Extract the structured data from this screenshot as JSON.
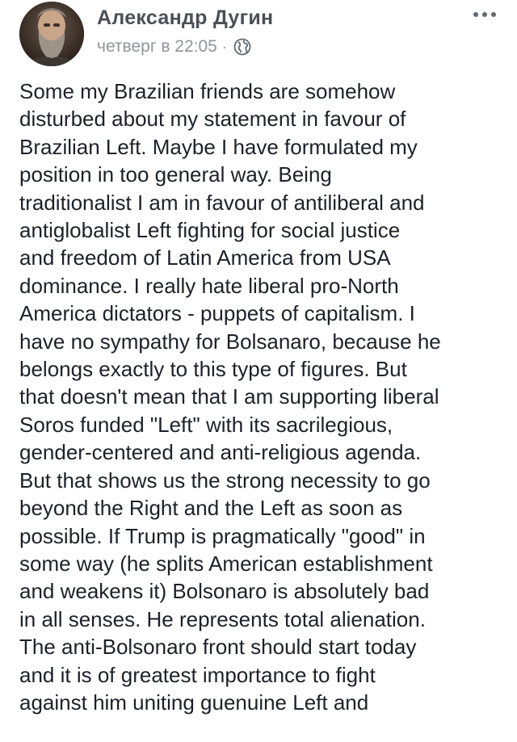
{
  "post": {
    "author_name": "Александр Дугин",
    "timestamp": "четверг в 22:05",
    "separator": "·",
    "privacy_icon": "globe-icon",
    "more_icon": "more-options-icon",
    "text_lines": [
      "Some my Brazilian friends are somehow",
      "disturbed about my statement in favour of",
      "Brazilian Left. Maybe I have formulated my",
      "position in too general way. Being",
      "traditionalist I am in favour of antiliberal and",
      "antiglobalist Left fighting for social justice",
      "and freedom of Latin America from USA",
      "dominance. I really hate liberal pro-North",
      "America dictators - puppets of capitalism. I",
      "have no sympathy for Bolsanaro, because he",
      "belongs exactly to this type of figures. But",
      "that doesn't mean that I am supporting liberal",
      "Soros funded \"Left\" with its sacrilegious,",
      "gender-centered and anti-religious agenda.",
      "But that shows us the strong necessity to go",
      "beyond the Right and the Left as soon as",
      "possible. If Trump is pragmatically \"good\" in",
      "some way (he splits American establishment",
      "and weakens it) Bolsonaro is absolutely bad",
      "in all senses. He represents total alienation.",
      "The anti-Bolsonaro front should start today",
      "and it is of greatest importance to fight",
      "against him uniting guenuine Left and"
    ]
  },
  "colors": {
    "author": "#4b4f56",
    "meta": "#90949c",
    "text": "#1d2129",
    "background": "#ffffff"
  }
}
